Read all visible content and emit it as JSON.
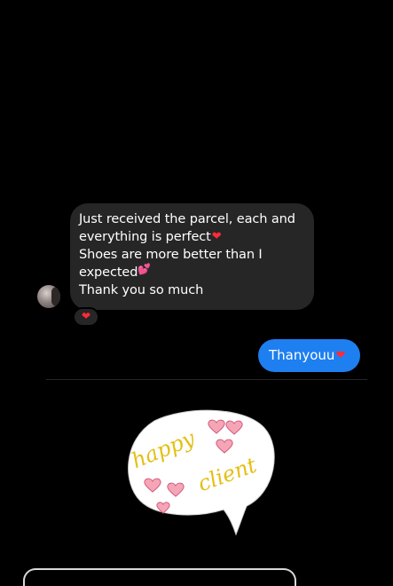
{
  "conversation": {
    "incoming_message": {
      "lines": [
        "Just received the parcel, each and",
        "everything is perfect",
        "Shoes are more better than I",
        "expected",
        "Thank you so much"
      ],
      "line_emojis": [
        "",
        "❤",
        "",
        "💕",
        ""
      ],
      "reaction": "❤"
    },
    "outgoing_message": {
      "text": "Thanyouu",
      "emoji": "❤"
    }
  },
  "sticker": {
    "line1": "happy",
    "line2": "client"
  },
  "colors": {
    "background": "#000000",
    "incoming_bubble": "#262626",
    "outgoing_bubble": "#1e7ff0",
    "heart": "#ff2b3a",
    "sticker_text": "#e4bf14"
  }
}
